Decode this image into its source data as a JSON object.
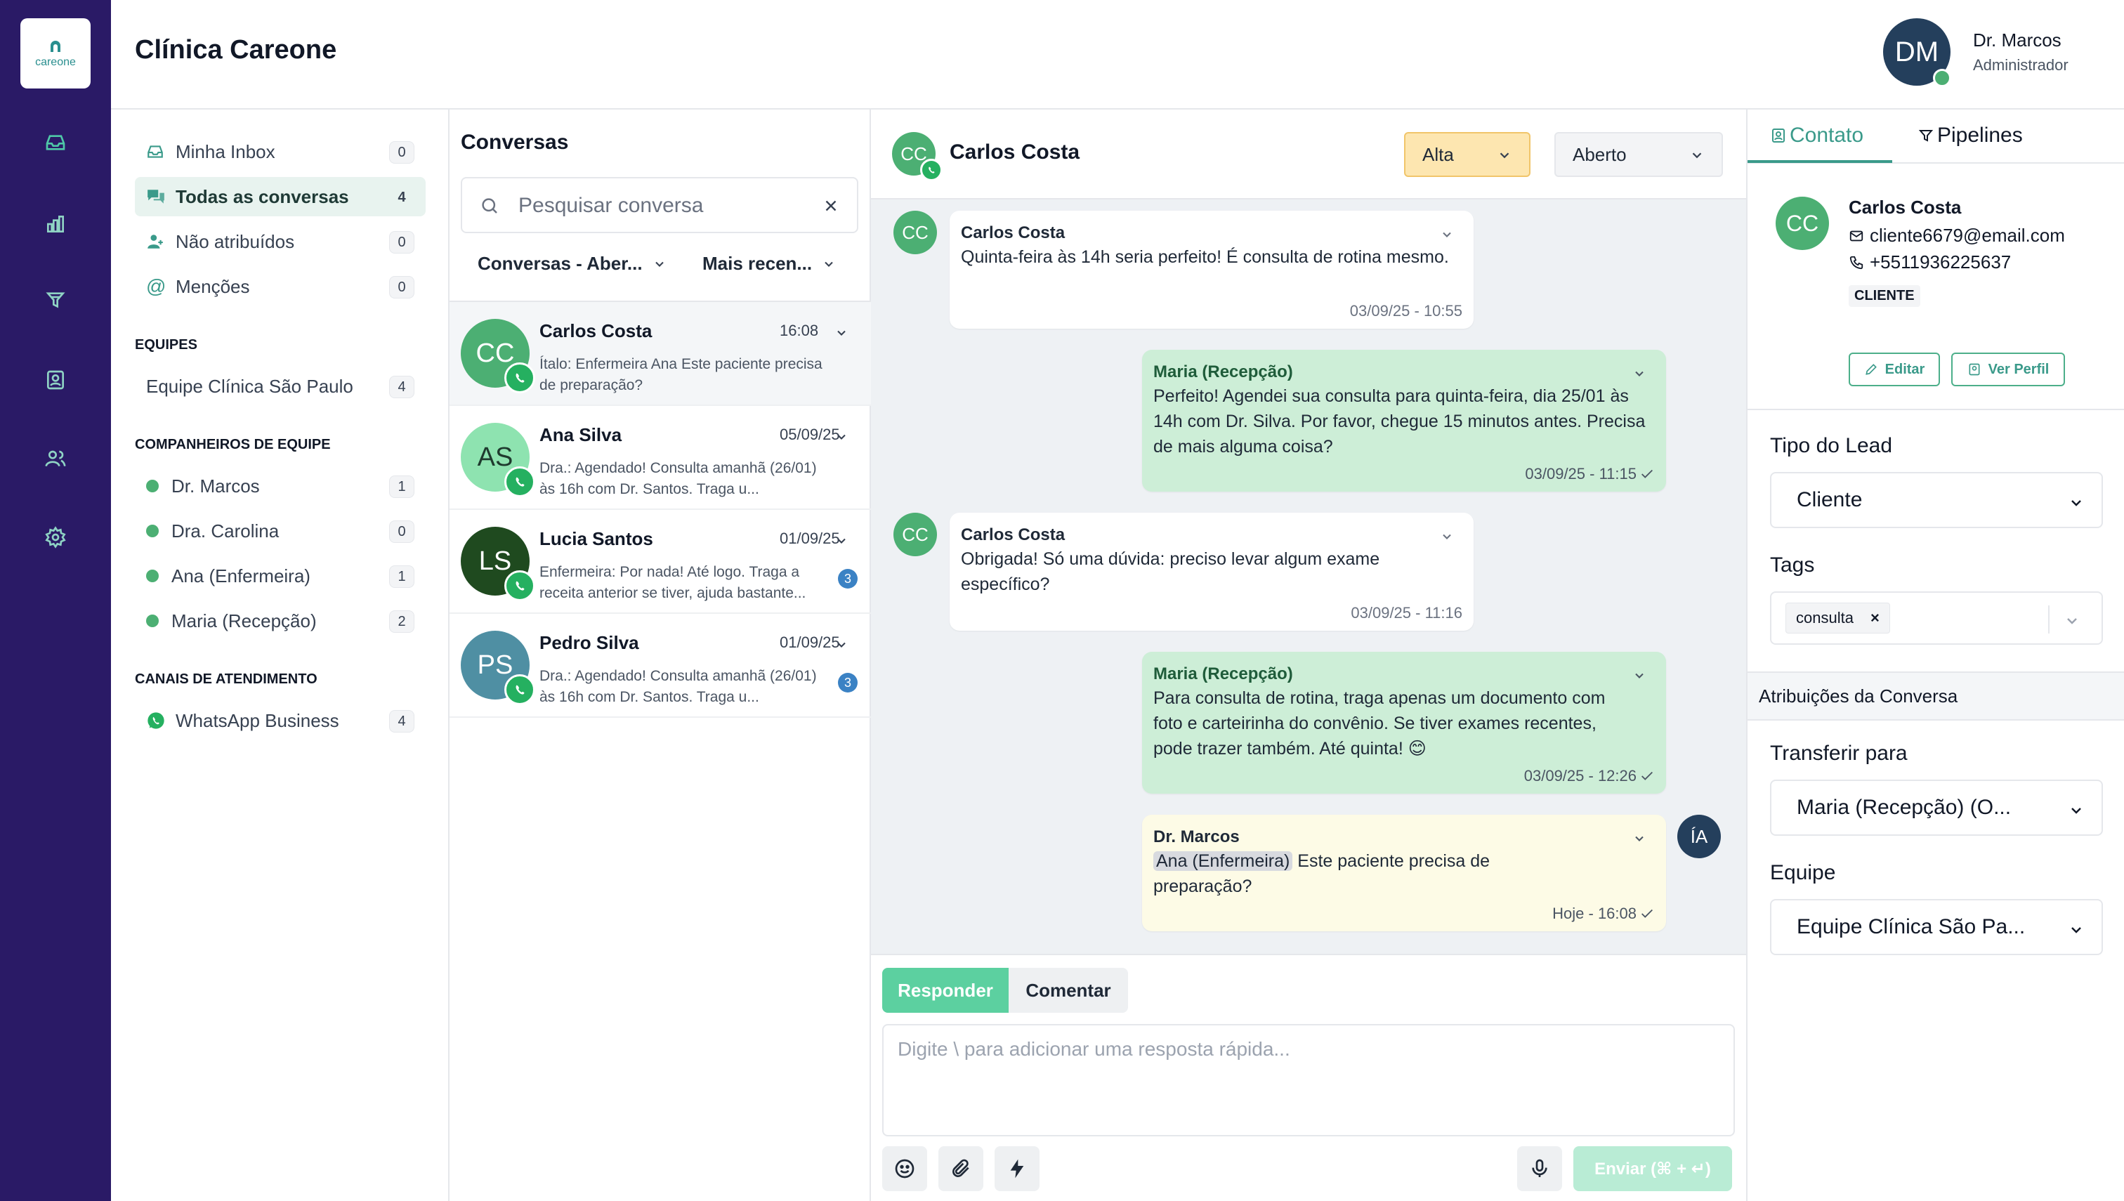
{
  "app": {
    "logo_text": "careone",
    "clinic_name": "Clínica Careone"
  },
  "colors": {
    "rail": "#2a1a66",
    "accent": "#3a9a8a",
    "whatsapp": "#25b060",
    "out_bubble": "#cdeed7",
    "note_bubble": "#fdfbe6"
  },
  "rail_icons": [
    "inbox-icon",
    "reports-icon",
    "funnel-icon",
    "contacts-icon",
    "team-icon",
    "settings-icon"
  ],
  "user": {
    "initials": "DM",
    "name": "Dr. Marcos",
    "role": "Administrador"
  },
  "sidebar": {
    "inboxes": [
      {
        "label": "Minha Inbox",
        "count": "0"
      },
      {
        "label": "Todas as conversas",
        "count": "4"
      },
      {
        "label": "Não atribuídos",
        "count": "0"
      },
      {
        "label": "Menções",
        "count": "0"
      }
    ],
    "teams_heading": "EQUIPES",
    "teams": [
      {
        "label": "Equipe Clínica São Paulo",
        "count": "4"
      }
    ],
    "mates_heading": "COMPANHEIROS DE EQUIPE",
    "mates": [
      {
        "label": "Dr. Marcos",
        "count": "1"
      },
      {
        "label": "Dra. Carolina",
        "count": "0"
      },
      {
        "label": "Ana (Enfermeira)",
        "count": "1"
      },
      {
        "label": "Maria (Recepção)",
        "count": "2"
      }
    ],
    "channels_heading": "CANAIS DE ATENDIMENTO",
    "channels": [
      {
        "label": "WhatsApp Business",
        "count": "4"
      }
    ]
  },
  "conversations": {
    "title": "Conversas",
    "search_placeholder": "Pesquisar conversa",
    "filter_status": "Conversas - Aber...",
    "filter_sort": "Mais recen...",
    "items": [
      {
        "initials": "CC",
        "color": "#4caf73",
        "name": "Carlos Costa",
        "time": "16:08",
        "preview": "Ítalo: Enfermeira Ana Este paciente precisa de preparação?",
        "unread": ""
      },
      {
        "initials": "AS",
        "color": "#8ee3b0",
        "name": "Ana Silva",
        "time": "05/09/25",
        "preview": "Dra.: Agendado! Consulta amanhã (26/01) às 16h com Dr. Santos. Traga u...",
        "unread": ""
      },
      {
        "initials": "LS",
        "color": "#1f4a1f",
        "name": "Lucia Santos",
        "time": "01/09/25",
        "preview": "Enfermeira: Por nada! Até logo. Traga a receita anterior se tiver, ajuda bastante...",
        "unread": "3"
      },
      {
        "initials": "PS",
        "color": "#4f8fa3",
        "name": "Pedro Silva",
        "time": "01/09/25",
        "preview": "Dra.: Agendado! Consulta amanhã (26/01) às 16h com Dr. Santos. Traga u...",
        "unread": "3"
      }
    ]
  },
  "chat": {
    "contact_initials": "CC",
    "contact_name": "Carlos Costa",
    "priority": "Alta",
    "status": "Aberto",
    "messages": [
      {
        "author": "Carlos Costa",
        "text": "Quinta-feira às 14h seria perfeito! É consulta de rotina mesmo.",
        "time": "03/09/25 - 10:55"
      },
      {
        "author": "Maria (Recepção)",
        "text": "Perfeito! Agendei sua consulta para quinta-feira, dia 25/01 às 14h com Dr. Silva. Por favor, chegue 15 minutos antes. Precisa de mais alguma coisa?",
        "time": "03/09/25 - 11:15"
      },
      {
        "author": "Carlos Costa",
        "text": "Obrigada! Só uma dúvida: preciso levar algum exame específico?",
        "time": "03/09/25 - 11:16"
      },
      {
        "author": "Maria (Recepção)",
        "text": "Para consulta de rotina, traga apenas um documento com foto e carteirinha do convênio. Se tiver exames recentes, pode trazer também. Até quinta! 😊",
        "time": "03/09/25 - 12:26"
      },
      {
        "author": "Dr. Marcos",
        "mention": "Ana (Enfermeira)",
        "text": " Este paciente precisa de preparação?",
        "time": "Hoje - 16:08",
        "avatar": "ÍA"
      }
    ],
    "composer": {
      "reply_tab": "Responder",
      "comment_tab": "Comentar",
      "placeholder": "Digite \\ para adicionar uma resposta rápida...",
      "send_label": "Enviar (⌘ + ↵)"
    }
  },
  "contact_panel": {
    "tab_contact": "Contato",
    "tab_pipelines": "Pipelines",
    "initials": "CC",
    "name": "Carlos Costa",
    "email": "cliente6679@email.com",
    "phone": "+5511936225637",
    "type_badge": "CLIENTE",
    "edit_label": "Editar",
    "profile_label": "Ver Perfil",
    "lead_type_label": "Tipo do Lead",
    "lead_type_value": "Cliente",
    "tags_label": "Tags",
    "tag": "consulta",
    "assignments_label": "Atribuições da Conversa",
    "transfer_label": "Transferir para",
    "transfer_value": "Maria (Recepção) (O...",
    "team_label": "Equipe",
    "team_value": "Equipe Clínica São Pa..."
  }
}
